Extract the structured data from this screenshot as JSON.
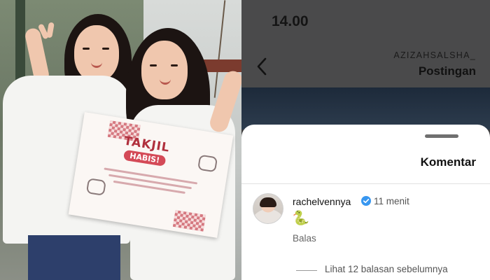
{
  "status_bar": {
    "time": "14.00"
  },
  "nav": {
    "username": "AZIZAHSALSHA_",
    "title": "Postingan",
    "back_icon": "chevron-left-icon"
  },
  "comments_sheet": {
    "title": "Komentar",
    "comment": {
      "username": "rachelvennya",
      "verified": true,
      "time": "11 menit",
      "body": "🐍",
      "reply_label": "Balas",
      "view_replies": "Lihat 12 balasan sebelumnya"
    }
  },
  "photo": {
    "sign_title": "TAKJIL",
    "sign_subtitle": "HABIS!"
  },
  "colors": {
    "verified_blue": "#3897f0",
    "sign_red": "#b0303d",
    "overlay_dark": "#3c3c3d"
  }
}
